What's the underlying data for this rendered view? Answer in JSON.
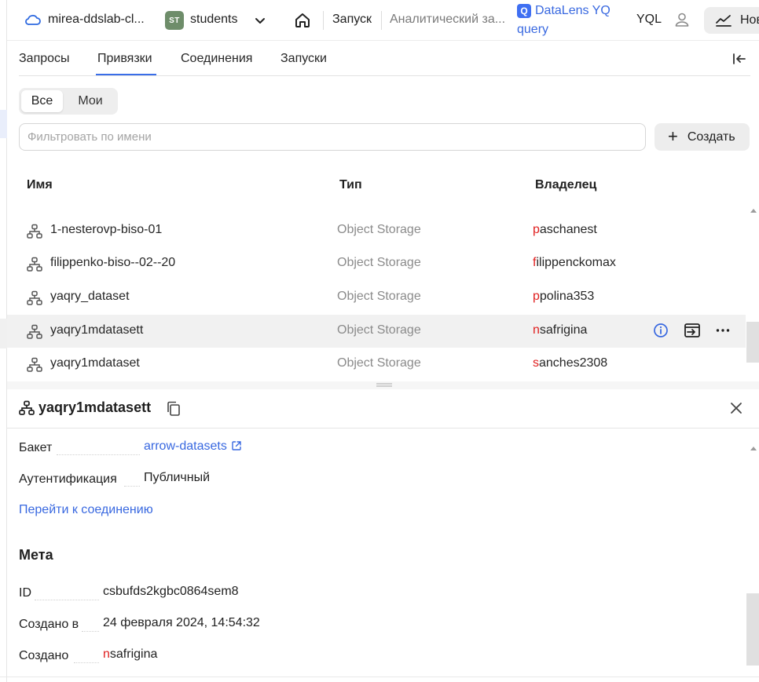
{
  "topbar": {
    "cloud_name": "mirea-ddslab-cl...",
    "folder_badge": "ST",
    "folder_name": "students",
    "launch": "Запуск",
    "analytic": "Аналитический за...",
    "datalens_badge": "Q",
    "datalens_title": "DataLens YQ",
    "datalens_sub": "query",
    "yql": "YQL",
    "new_button": "Новы"
  },
  "tabs": [
    "Запросы",
    "Привязки",
    "Соединения",
    "Запуски"
  ],
  "active_tab": "Привязки",
  "segmented": {
    "all": "Все",
    "mine": "Мои"
  },
  "filter": {
    "placeholder": "Фильтровать по имени",
    "value": ""
  },
  "create_button": "Создать",
  "table": {
    "headers": {
      "name": "Имя",
      "type": "Тип",
      "owner": "Владелец"
    },
    "rows": [
      {
        "name": "1-nesterovp-biso-01",
        "type": "Object Storage",
        "owner_first": "p",
        "owner_rest": "aschanest"
      },
      {
        "name": "filippenko-biso--02--20",
        "type": "Object Storage",
        "owner_first": "f",
        "owner_rest": "ilippenckomax"
      },
      {
        "name": "yaqry_dataset",
        "type": "Object Storage",
        "owner_first": "p",
        "owner_rest": "polina353"
      },
      {
        "name": "yaqry1mdatasett",
        "type": "Object Storage",
        "owner_first": "n",
        "owner_rest": "safrigina"
      },
      {
        "name": "yaqry1mdataset",
        "type": "Object Storage",
        "owner_first": "s",
        "owner_rest": "anches2308"
      }
    ]
  },
  "detail": {
    "title": "yaqry1mdatasett",
    "bucket_label": "Бакет",
    "bucket_value": "arrow-datasets",
    "auth_label": "Аутентификация",
    "auth_value": "Публичный",
    "goto_link": "Перейти к соединению",
    "meta_heading": "Мета",
    "id_label": "ID",
    "id_value": "csbufds2kgbc0864sem8",
    "created_at_label": "Создано в",
    "created_at_value": "24 февраля 2024, 14:54:32",
    "created_by_label": "Создано",
    "created_by_first": "n",
    "created_by_rest": "safrigina"
  },
  "colors": {
    "accent": "#3868e0",
    "owner_initial": "#e02020",
    "folder_badge": "#6e8d6a"
  }
}
